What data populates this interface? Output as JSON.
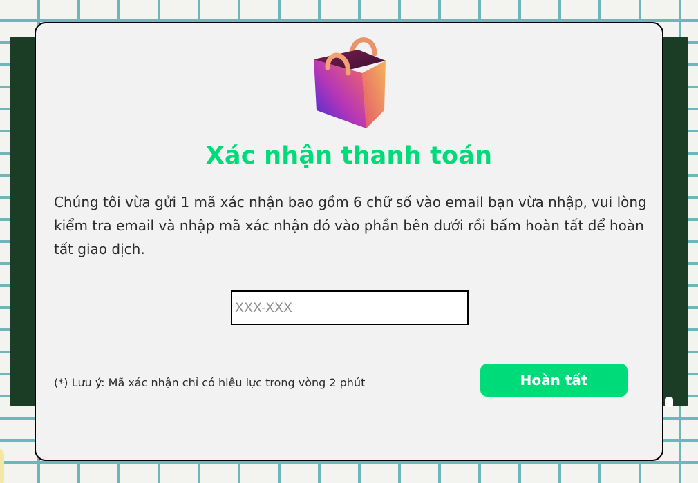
{
  "page": {
    "title": "Xác nhận thanh toán",
    "accent_color": "#00db79"
  },
  "header_icon": {
    "name": "shopping-bag-icon"
  },
  "description": "Chúng tôi vừa gửi 1 mã xác nhận bao gồm 6 chữ số vào email bạn vừa nhập, vui lòng kiểm tra email và nhập mã xác nhận đó vào phần bên dưới rồi bấm hoàn tất để hoàn tất giao dịch.",
  "code_input": {
    "value": "",
    "placeholder": "XXX-XXX"
  },
  "note": "(*) Lưu ý: Mã xác nhận chỉ có hiệu lực trong vòng 2 phút",
  "submit": {
    "label": "Hoàn tất"
  }
}
